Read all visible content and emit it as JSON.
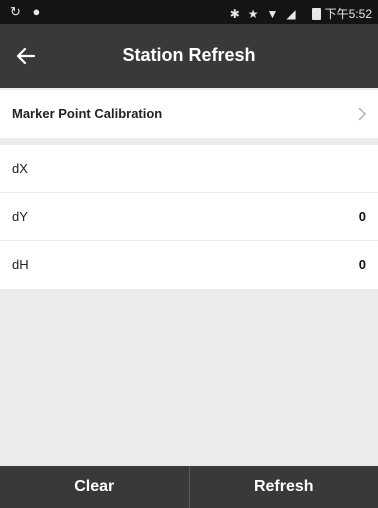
{
  "status_bar": {
    "left_icons": [
      "sync-icon",
      "location-pin-icon"
    ],
    "right_icons": [
      "bluetooth-icon",
      "star-icon",
      "wifi-icon",
      "signal-icon",
      "battery-icon"
    ],
    "time": "下午5:52"
  },
  "toolbar": {
    "title": "Station Refresh",
    "back_icon": "arrow-left-icon"
  },
  "calibration": {
    "label": "Marker Point Calibration",
    "chevron_icon": "chevron-right-icon"
  },
  "rows": [
    {
      "label": "dX",
      "value": ""
    },
    {
      "label": "dY",
      "value": "0"
    },
    {
      "label": "dH",
      "value": "0"
    }
  ],
  "buttons": {
    "clear": "Clear",
    "refresh": "Refresh"
  },
  "colors": {
    "toolbar_bg": "#393939",
    "status_bg": "#141414",
    "page_bg": "#ebebeb"
  }
}
